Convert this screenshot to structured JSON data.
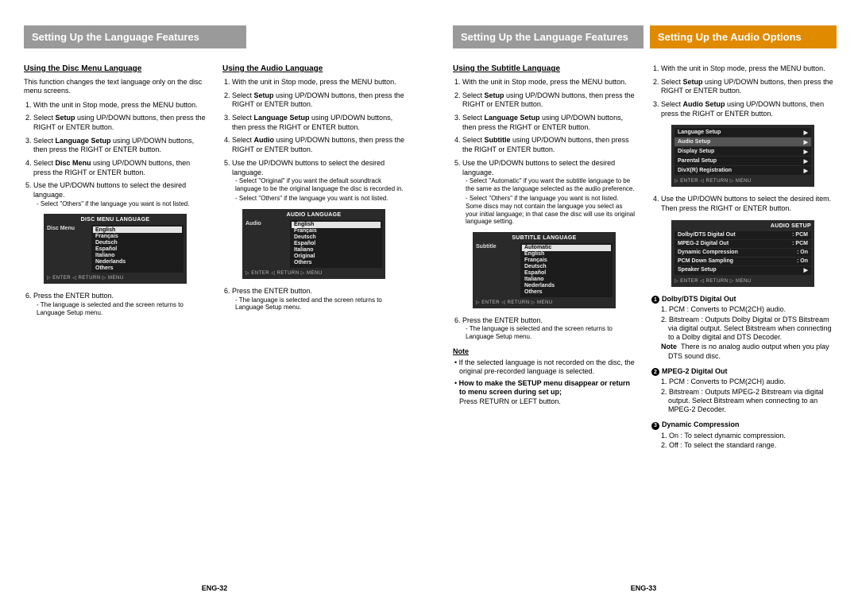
{
  "left": {
    "header": "Setting Up the Language Features",
    "footer": "ENG-32",
    "col1": {
      "heading": "Using the Disc Menu Language",
      "intro": "This function changes the text language only on the disc menu screens.",
      "s1": "With the unit in Stop mode, press the MENU button.",
      "s2a": "Select ",
      "s2b": "Setup",
      "s2c": " using UP/DOWN buttons, then press the RIGHT or ENTER button.",
      "s3a": "Select ",
      "s3b": "Language Setup",
      "s3c": " using UP/DOWN buttons, then press the RIGHT or ENTER button.",
      "s4a": "Select ",
      "s4b": "Disc Menu",
      "s4c": " using UP/DOWN buttons, then press the RIGHT or ENTER button.",
      "s5": "Use the UP/DOWN buttons to select the desired language.",
      "s5sub": "Select \"Others\" if the language you want is not listed.",
      "s6": "Press the ENTER button.",
      "s6sub": "The language is selected and the screen returns to Language Setup menu.",
      "osd": {
        "title": "DISC MENU LANGUAGE",
        "left": "Disc Menu",
        "opts": [
          "English",
          "Français",
          "Deutsch",
          "Español",
          "Italiano",
          "Nederlands",
          "Others"
        ],
        "foot": "▷ ENTER   ◁ RETURN   ▷ MENU"
      }
    },
    "col2": {
      "heading": "Using the Audio Language",
      "s1": "With the unit in Stop mode, press the MENU button.",
      "s2a": "Select ",
      "s2b": "Setup",
      "s2c": " using UP/DOWN buttons, then press the RIGHT or ENTER button.",
      "s3a": "Select ",
      "s3b": "Language Setup",
      "s3c": " using UP/DOWN buttons, then press the RIGHT or ENTER button.",
      "s4a": "Select ",
      "s4b": "Audio",
      "s4c": " using UP/DOWN buttons, then press the RIGHT or ENTER button.",
      "s5": "Use the UP/DOWN buttons to select the desired language.",
      "s5sub1": "Select \"Original\" if you want the default soundtrack language to be the original language the disc is recorded in.",
      "s5sub2": "Select \"Others\" if the language you want is not listed.",
      "s6": "Press the ENTER button.",
      "s6sub": "The language is selected and the screen returns to Language Setup menu.",
      "osd": {
        "title": "AUDIO LANGUAGE",
        "left": "Audio",
        "opts": [
          "English",
          "Français",
          "Deutsch",
          "Español",
          "Italiano",
          "Original",
          "Others"
        ],
        "foot": "▷ ENTER   ◁ RETURN   ▷ MENU"
      }
    }
  },
  "right": {
    "header_gray": "Setting Up the Language Features",
    "header_orange": "Setting Up the Audio Options",
    "footer": "ENG-33",
    "col1": {
      "heading": "Using the Subtitle Language",
      "s1": "With the unit in Stop mode, press the MENU button.",
      "s2a": "Select ",
      "s2b": "Setup",
      "s2c": " using UP/DOWN buttons, then press the RIGHT or ENTER button.",
      "s3a": "Select ",
      "s3b": "Language Setup",
      "s3c": " using UP/DOWN buttons, then press the RIGHT or ENTER button.",
      "s4a": "Select ",
      "s4b": "Subtitle",
      "s4c": " using UP/DOWN buttons, then press the RIGHT or ENTER button.",
      "s5": "Use the UP/DOWN buttons to select the desired language.",
      "s5sub1": "Select \"Automatic\" if you want the subtitle language to be the same as the language selected as the audio preference.",
      "s5sub2": "Select \"Others\" if the language you want is not listed. Some discs may not contain the language you select as your initial language; in that case the disc will use its original language setting.",
      "s6": "Press the ENTER button.",
      "s6sub": "The language is selected and the screen returns to Language Setup menu.",
      "osd": {
        "title": "SUBTITLE LANGUAGE",
        "left": "Subtitle",
        "opts": [
          "Automatic",
          "English",
          "Français",
          "Deutsch",
          "Español",
          "Italiano",
          "Nederlands",
          "Others"
        ],
        "foot": "▷ ENTER   ◁ RETURN   ▷ MENU"
      },
      "noteH": "Note",
      "note1": "If the selected language is not recorded on the disc, the original pre-recorded language is selected.",
      "note2a": "How to make the SETUP menu disappear or return to menu screen during set up;",
      "note2b": "Press RETURN or LEFT button."
    },
    "col2": {
      "s1": "With the unit in Stop mode, press the MENU button.",
      "s2a": "Select ",
      "s2b": "Setup",
      "s2c": " using UP/DOWN buttons, then press the RIGHT or ENTER button.",
      "s3a": "Select ",
      "s3b": "Audio Setup",
      "s3c": " using UP/DOWN buttons, then press the RIGHT or ENTER button.",
      "s4": "Use the UP/DOWN buttons to select the desired item. Then press the RIGHT or ENTER button.",
      "menu1": {
        "rows": [
          {
            "lab": "Language Setup",
            "val": "▶"
          },
          {
            "lab": "Audio Setup",
            "val": "▶",
            "sel": true
          },
          {
            "lab": "Display Setup",
            "val": "▶"
          },
          {
            "lab": "Parental Setup",
            "val": "▶"
          },
          {
            "lab": "DivX(R) Registration",
            "val": "▶"
          }
        ],
        "foot": "▷ ENTER   ◁ RETURN   ▷ MENU"
      },
      "menu2": {
        "title": "AUDIO SETUP",
        "rows": [
          {
            "lab": "Dolby/DTS Digital Out",
            "val": ": PCM"
          },
          {
            "lab": "MPEG-2 Digital Out",
            "val": ": PCM"
          },
          {
            "lab": "Dynamic Compression",
            "val": ": On"
          },
          {
            "lab": "PCM Down Sampling",
            "val": ": On"
          },
          {
            "lab": "Speaker Setup",
            "val": "▶"
          }
        ],
        "foot": "▷ ENTER   ◁ RETURN   ▷ MENU"
      },
      "opt1": {
        "num": "1",
        "title": "Dolby/DTS Digital Out",
        "i1": "1. PCM : Converts to PCM(2CH) audio.",
        "i2": "2. Bitstream : Outputs Dolby Digital or DTS Bitstream via digital output. Select Bitstream when connecting to a Dolby digital and DTS Decoder.",
        "noteA": "Note",
        "noteB": "There is no analog audio output when you play DTS sound disc."
      },
      "opt2": {
        "num": "2",
        "title": "MPEG-2 Digital Out",
        "i1": "1. PCM : Converts to PCM(2CH) audio.",
        "i2": "2. Bitstream : Outputs MPEG-2 Bitstream via digital output. Select Bitstream when connecting to an MPEG-2 Decoder."
      },
      "opt3": {
        "num": "3",
        "title": "Dynamic Compression",
        "i1": "1. On : To select dynamic compression.",
        "i2": "2. Off : To select the standard range."
      }
    }
  }
}
